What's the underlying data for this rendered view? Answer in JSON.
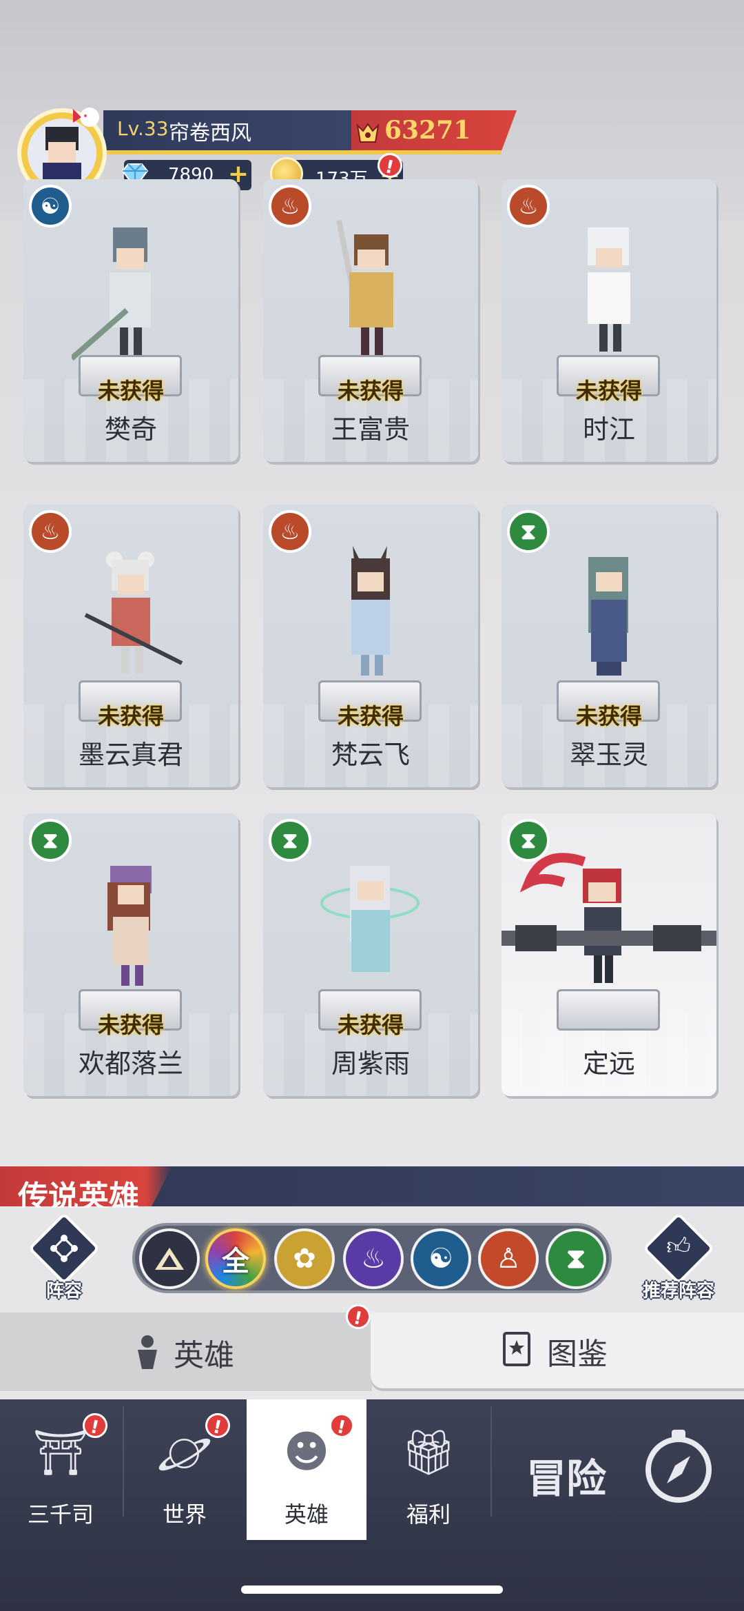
{
  "player": {
    "level": "Lv.33",
    "name": "帘卷西风",
    "power": "63271",
    "gems": "7890",
    "gold": "173万"
  },
  "heroes": [
    {
      "name": "樊奇",
      "status": "未获得",
      "faction": "yin-yang",
      "color": "#1f5d8f"
    },
    {
      "name": "王富贵",
      "status": "未获得",
      "faction": "meditation",
      "color": "#b94a2a"
    },
    {
      "name": "时江",
      "status": "未获得",
      "faction": "meditation",
      "color": "#b94a2a"
    },
    {
      "name": "墨云真君",
      "status": "未获得",
      "faction": "meditation",
      "color": "#b94a2a"
    },
    {
      "name": "梵云飞",
      "status": "未获得",
      "faction": "meditation",
      "color": "#b94a2a"
    },
    {
      "name": "翠玉灵",
      "status": "未获得",
      "faction": "dna",
      "color": "#2e8a3e"
    },
    {
      "name": "欢都落兰",
      "status": "未获得",
      "faction": "dna",
      "color": "#2e8a3e"
    },
    {
      "name": "周紫雨",
      "status": "未获得",
      "faction": "dna",
      "color": "#2e8a3e"
    },
    {
      "name": "定远",
      "status": "",
      "faction": "dna",
      "color": "#2e8a3e"
    }
  ],
  "section": {
    "legend_title": "传说英雄"
  },
  "filter": {
    "lineup_label": "阵容",
    "recommend_label": "推荐阵容",
    "chips": [
      {
        "icon": "triangle-rank-icon",
        "label": "",
        "color": "#2f3242"
      },
      {
        "icon": "all-icon",
        "label": "全",
        "color": "#6a4aa0"
      },
      {
        "icon": "lotus-icon",
        "label": "",
        "color": "#c9a233"
      },
      {
        "icon": "flame-icon",
        "label": "",
        "color": "#5a3aa5"
      },
      {
        "icon": "yin-yang-icon",
        "label": "",
        "color": "#1f5d8f"
      },
      {
        "icon": "meditation-icon",
        "label": "",
        "color": "#c24a2a"
      },
      {
        "icon": "dna-icon",
        "label": "",
        "color": "#2e8a3e"
      }
    ]
  },
  "tabs": {
    "heroes": "英雄",
    "codex": "图鉴"
  },
  "nav": {
    "items": [
      {
        "label": "三千司"
      },
      {
        "label": "世界"
      },
      {
        "label": "英雄"
      },
      {
        "label": "福利"
      }
    ],
    "adventure": "冒险"
  }
}
